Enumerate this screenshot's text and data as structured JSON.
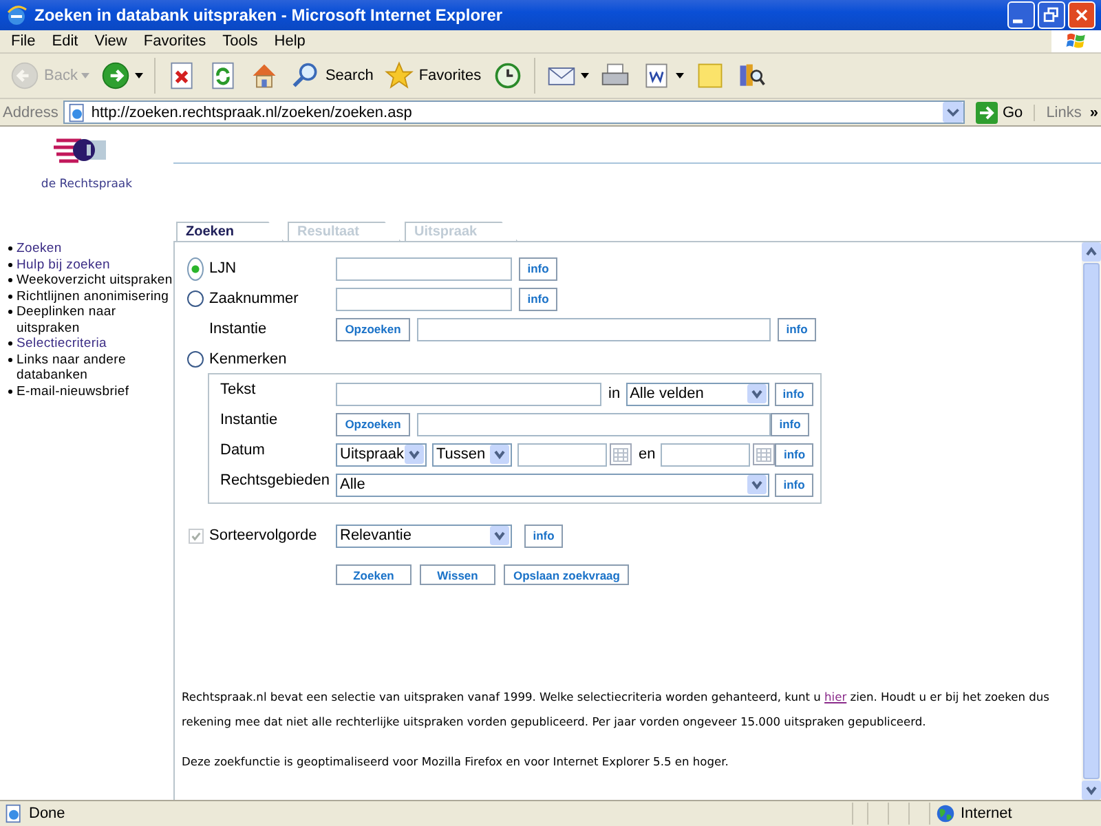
{
  "window": {
    "title": "Zoeken in databank uitspraken - Microsoft Internet Explorer"
  },
  "menu": [
    "File",
    "Edit",
    "View",
    "Favorites",
    "Tools",
    "Help"
  ],
  "toolbar": [
    {
      "kind": "back",
      "label": "Back",
      "disabled": true,
      "menu": true
    },
    {
      "kind": "forward",
      "disabled": false,
      "menu": true
    },
    {
      "kind": "stop",
      "disabled": false,
      "menu": false
    },
    {
      "kind": "refresh",
      "disabled": false,
      "menu": false
    },
    {
      "kind": "home",
      "disabled": false,
      "menu": false
    },
    {
      "kind": "search",
      "label": "Search",
      "disabled": false,
      "menu": false
    },
    {
      "kind": "favorites",
      "label": "Favorites",
      "disabled": false,
      "menu": false
    },
    {
      "kind": "history",
      "disabled": false,
      "menu": false
    },
    {
      "kind": "mail",
      "disabled": false,
      "menu": true
    },
    {
      "kind": "print",
      "disabled": false,
      "menu": false
    },
    {
      "kind": "edit",
      "disabled": false,
      "menu": true
    },
    {
      "kind": "note",
      "disabled": false,
      "menu": false
    },
    {
      "kind": "research",
      "disabled": false,
      "menu": false
    }
  ],
  "address": {
    "label": "Address",
    "value": "http://zoeken.rechtspraak.nl/zoeken/zoeken.asp",
    "go": "Go",
    "links": "Links",
    "more": "»"
  },
  "site": {
    "name": "de Rechtspraak"
  },
  "nav": [
    {
      "label": "Zoeken",
      "visited": true
    },
    {
      "label": "Hulp bij zoeken",
      "visited": true
    },
    {
      "label": "Weekoverzicht uitspraken",
      "visited": false
    },
    {
      "label": "Richtlijnen anonimisering",
      "visited": false
    },
    {
      "label": "Deeplinken naar uitspraken",
      "visited": false
    },
    {
      "label": "Selectiecriteria",
      "visited": true
    },
    {
      "label": "Links naar andere databanken",
      "visited": false
    },
    {
      "label": "E-mail-nieuwsbrief",
      "visited": false
    }
  ],
  "tabs": [
    {
      "label": "Zoeken",
      "selected": true
    },
    {
      "label": "Resultaat",
      "selected": false
    },
    {
      "label": "Uitspraak",
      "selected": false
    }
  ],
  "ljn": {
    "label": "LJN",
    "selected": true,
    "info": "info"
  },
  "zaaknummer": {
    "label": "Zaaknummer",
    "selected": false,
    "info": "info"
  },
  "instantie": {
    "label": "Instantie",
    "button": "Opzoeken",
    "info": "info"
  },
  "kenmerken": {
    "label": "Kenmerken",
    "selected": false,
    "rows": [
      {
        "kind": "text",
        "label": "Tekst",
        "joiner": "in",
        "select": "Alle velden",
        "info": "info"
      },
      {
        "kind": "lookup",
        "label": "Instantie",
        "button": "Opzoeken",
        "info": "info"
      },
      {
        "kind": "date",
        "label": "Datum",
        "selects": [
          "Uitspraak",
          "Tussen"
        ],
        "joiner": "en",
        "info": "info"
      },
      {
        "kind": "select",
        "label": "Rechtsgebieden",
        "select": "Alle",
        "info": "info"
      }
    ]
  },
  "sort": {
    "label": "Sorteervolgorde",
    "checked": true,
    "disabled": true,
    "select": "Relevantie",
    "info": "info"
  },
  "actions": [
    "Zoeken",
    "Wissen",
    "Opslaan zoekvraag"
  ],
  "notes": [
    {
      "before": "Rechtspraak.nl bevat een selectie van uitspraken vanaf 1999. Welke selectiecriteria worden gehanteerd, kunt u ",
      "link": "hier",
      "after": " zien. Houdt u er bij het zoeken dus rekening mee dat niet alle rechterlijke uitspraken vorden gepubliceerd. Per jaar vorden ongeveer 15.000 uitspraken gepubliceerd."
    },
    {
      "before": "Deze zoekfunctie is geoptimaliseerd voor Mozilla Firefox en voor Internet Explorer 5.5 en hoger."
    }
  ],
  "status": {
    "text": "Done",
    "zone": "Internet"
  }
}
